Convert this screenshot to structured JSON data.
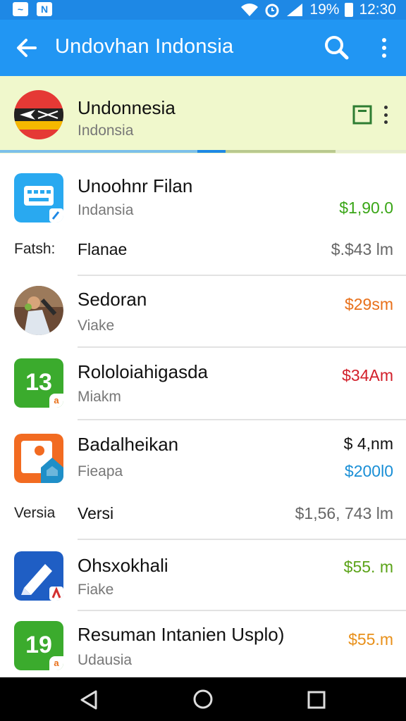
{
  "status_bar": {
    "battery": "19%",
    "time": "12:30",
    "icons": [
      "image-icon",
      "n-app-icon",
      "wifi-icon",
      "alarm-icon",
      "signal-icon",
      "battery-icon"
    ]
  },
  "app_bar": {
    "title": "Undovhan Indonsia",
    "icons": [
      "back-arrow-icon",
      "search-icon",
      "more-vert-icon"
    ]
  },
  "header": {
    "title": "Undonnesia",
    "subtitle": "Indonsia",
    "icons": [
      "flag-icon",
      "bookmark-icon",
      "more-vert-icon"
    ]
  },
  "list": [
    {
      "title": "Unoohnr Filan",
      "subtitle": "Indansia",
      "amount": "$1,90.0",
      "amount_color": "#3aa617",
      "icon": "keyboard-app-icon"
    },
    {
      "label": "Fatsh:",
      "name": "Flanae",
      "amount": "$.$43 lm"
    },
    {
      "title": "Sedoran",
      "subtitle": "Viake",
      "amount": "$29sm",
      "amount_color": "#e8701a",
      "icon": "photo-avatar"
    },
    {
      "title": "Rololoiahigasda",
      "subtitle": "Miakm",
      "amount": "$34Am",
      "amount_color": "#d21f2a",
      "icon": "calendar-13-icon",
      "tile_text": "13"
    },
    {
      "title": "Badalheikan",
      "subtitle": "Fieapa",
      "amount": "$ 4,nm",
      "amount2": "$200l0",
      "amount_color": "#111111",
      "amount2_color": "#1a8fd6",
      "icon": "orange-app-icon"
    },
    {
      "label": "Versia",
      "name": "Versi",
      "amount": "$1,56, 743 lm"
    },
    {
      "title": "Ohsxokhali",
      "subtitle": "Fiake",
      "amount": "$55. m",
      "amount_color": "#5ba318",
      "icon": "blue-pen-app-icon"
    },
    {
      "title": "Resuman Intanien Usplo)",
      "subtitle": "Udausia",
      "amount": "$55.m",
      "amount_color": "#e8901a",
      "icon": "calendar-19-icon",
      "tile_text": "19"
    }
  ],
  "nav_bar": {
    "icons": [
      "nav-back-icon",
      "nav-home-icon",
      "nav-recents-icon"
    ]
  }
}
